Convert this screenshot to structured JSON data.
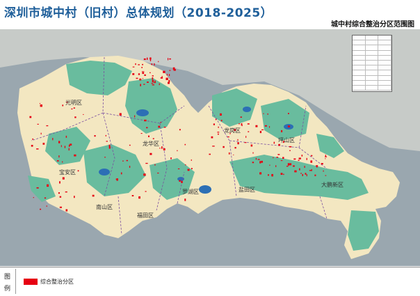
{
  "title": "深圳市城中村（旧村）总体规划（2018-2025）",
  "map_name": "城中村综合整治分区范围图",
  "districts": [
    {
      "name": "宝安区"
    },
    {
      "name": "光明区"
    },
    {
      "name": "龙华区"
    },
    {
      "name": "龙岗区"
    },
    {
      "name": "坪山区"
    },
    {
      "name": "大鹏新区"
    },
    {
      "name": "盐田区"
    },
    {
      "name": "罗湖区"
    },
    {
      "name": "福田区"
    },
    {
      "name": "南山区"
    }
  ],
  "legend": {
    "title": "图例",
    "items": [
      {
        "label": "综合整治分区",
        "color": "#e60012"
      }
    ]
  },
  "colors": {
    "sea": "#9aa7af",
    "land": "#f3e7c1",
    "ecology": "#69bc9e",
    "water": "#2c6fb5",
    "outside": "#c7cbc8",
    "renovation": "#e60012"
  },
  "stats_table_rows": 11
}
